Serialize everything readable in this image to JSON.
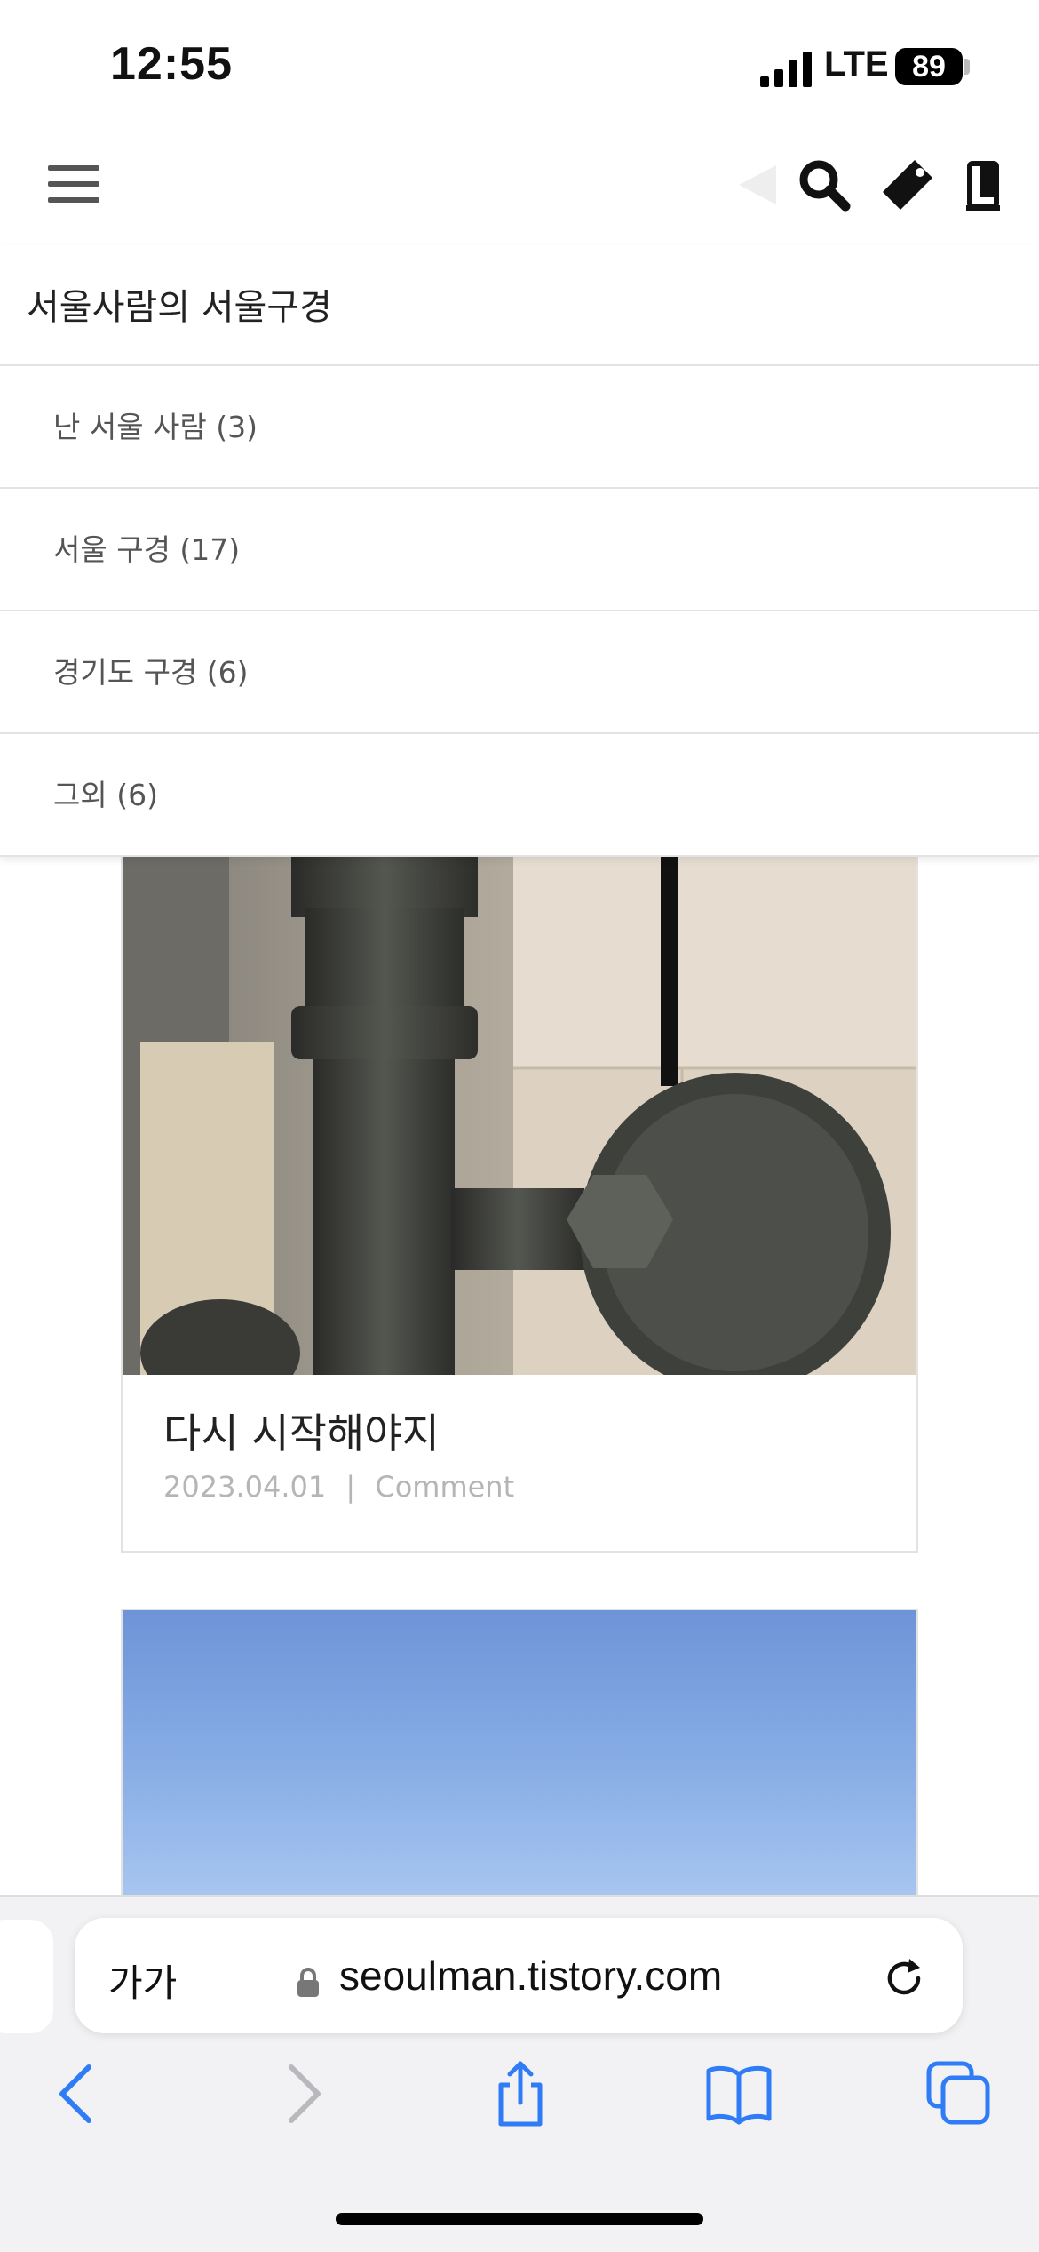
{
  "status_bar": {
    "time": "12:55",
    "network": "LTE",
    "battery": "89"
  },
  "header": {
    "menu_icon": "hamburger-icon",
    "icons": [
      "back-arrow-icon",
      "search-icon",
      "tag-icon",
      "guestbook-icon"
    ]
  },
  "menu": {
    "title": "서울사람의 서울구경",
    "items": [
      {
        "label": "난 서울 사람 (3)"
      },
      {
        "label": "서울 구경 (17)"
      },
      {
        "label": "경기도 구경 (6)"
      },
      {
        "label": "그외 (6)"
      }
    ]
  },
  "posts": [
    {
      "title": "다시 시작해야지",
      "date": "2023.04.01",
      "separator": "|",
      "comment_label": "Comment"
    }
  ],
  "browser": {
    "text_size_label": "가가",
    "url": "seoulman.tistory.com",
    "accent_color": "#2f7cf6"
  }
}
